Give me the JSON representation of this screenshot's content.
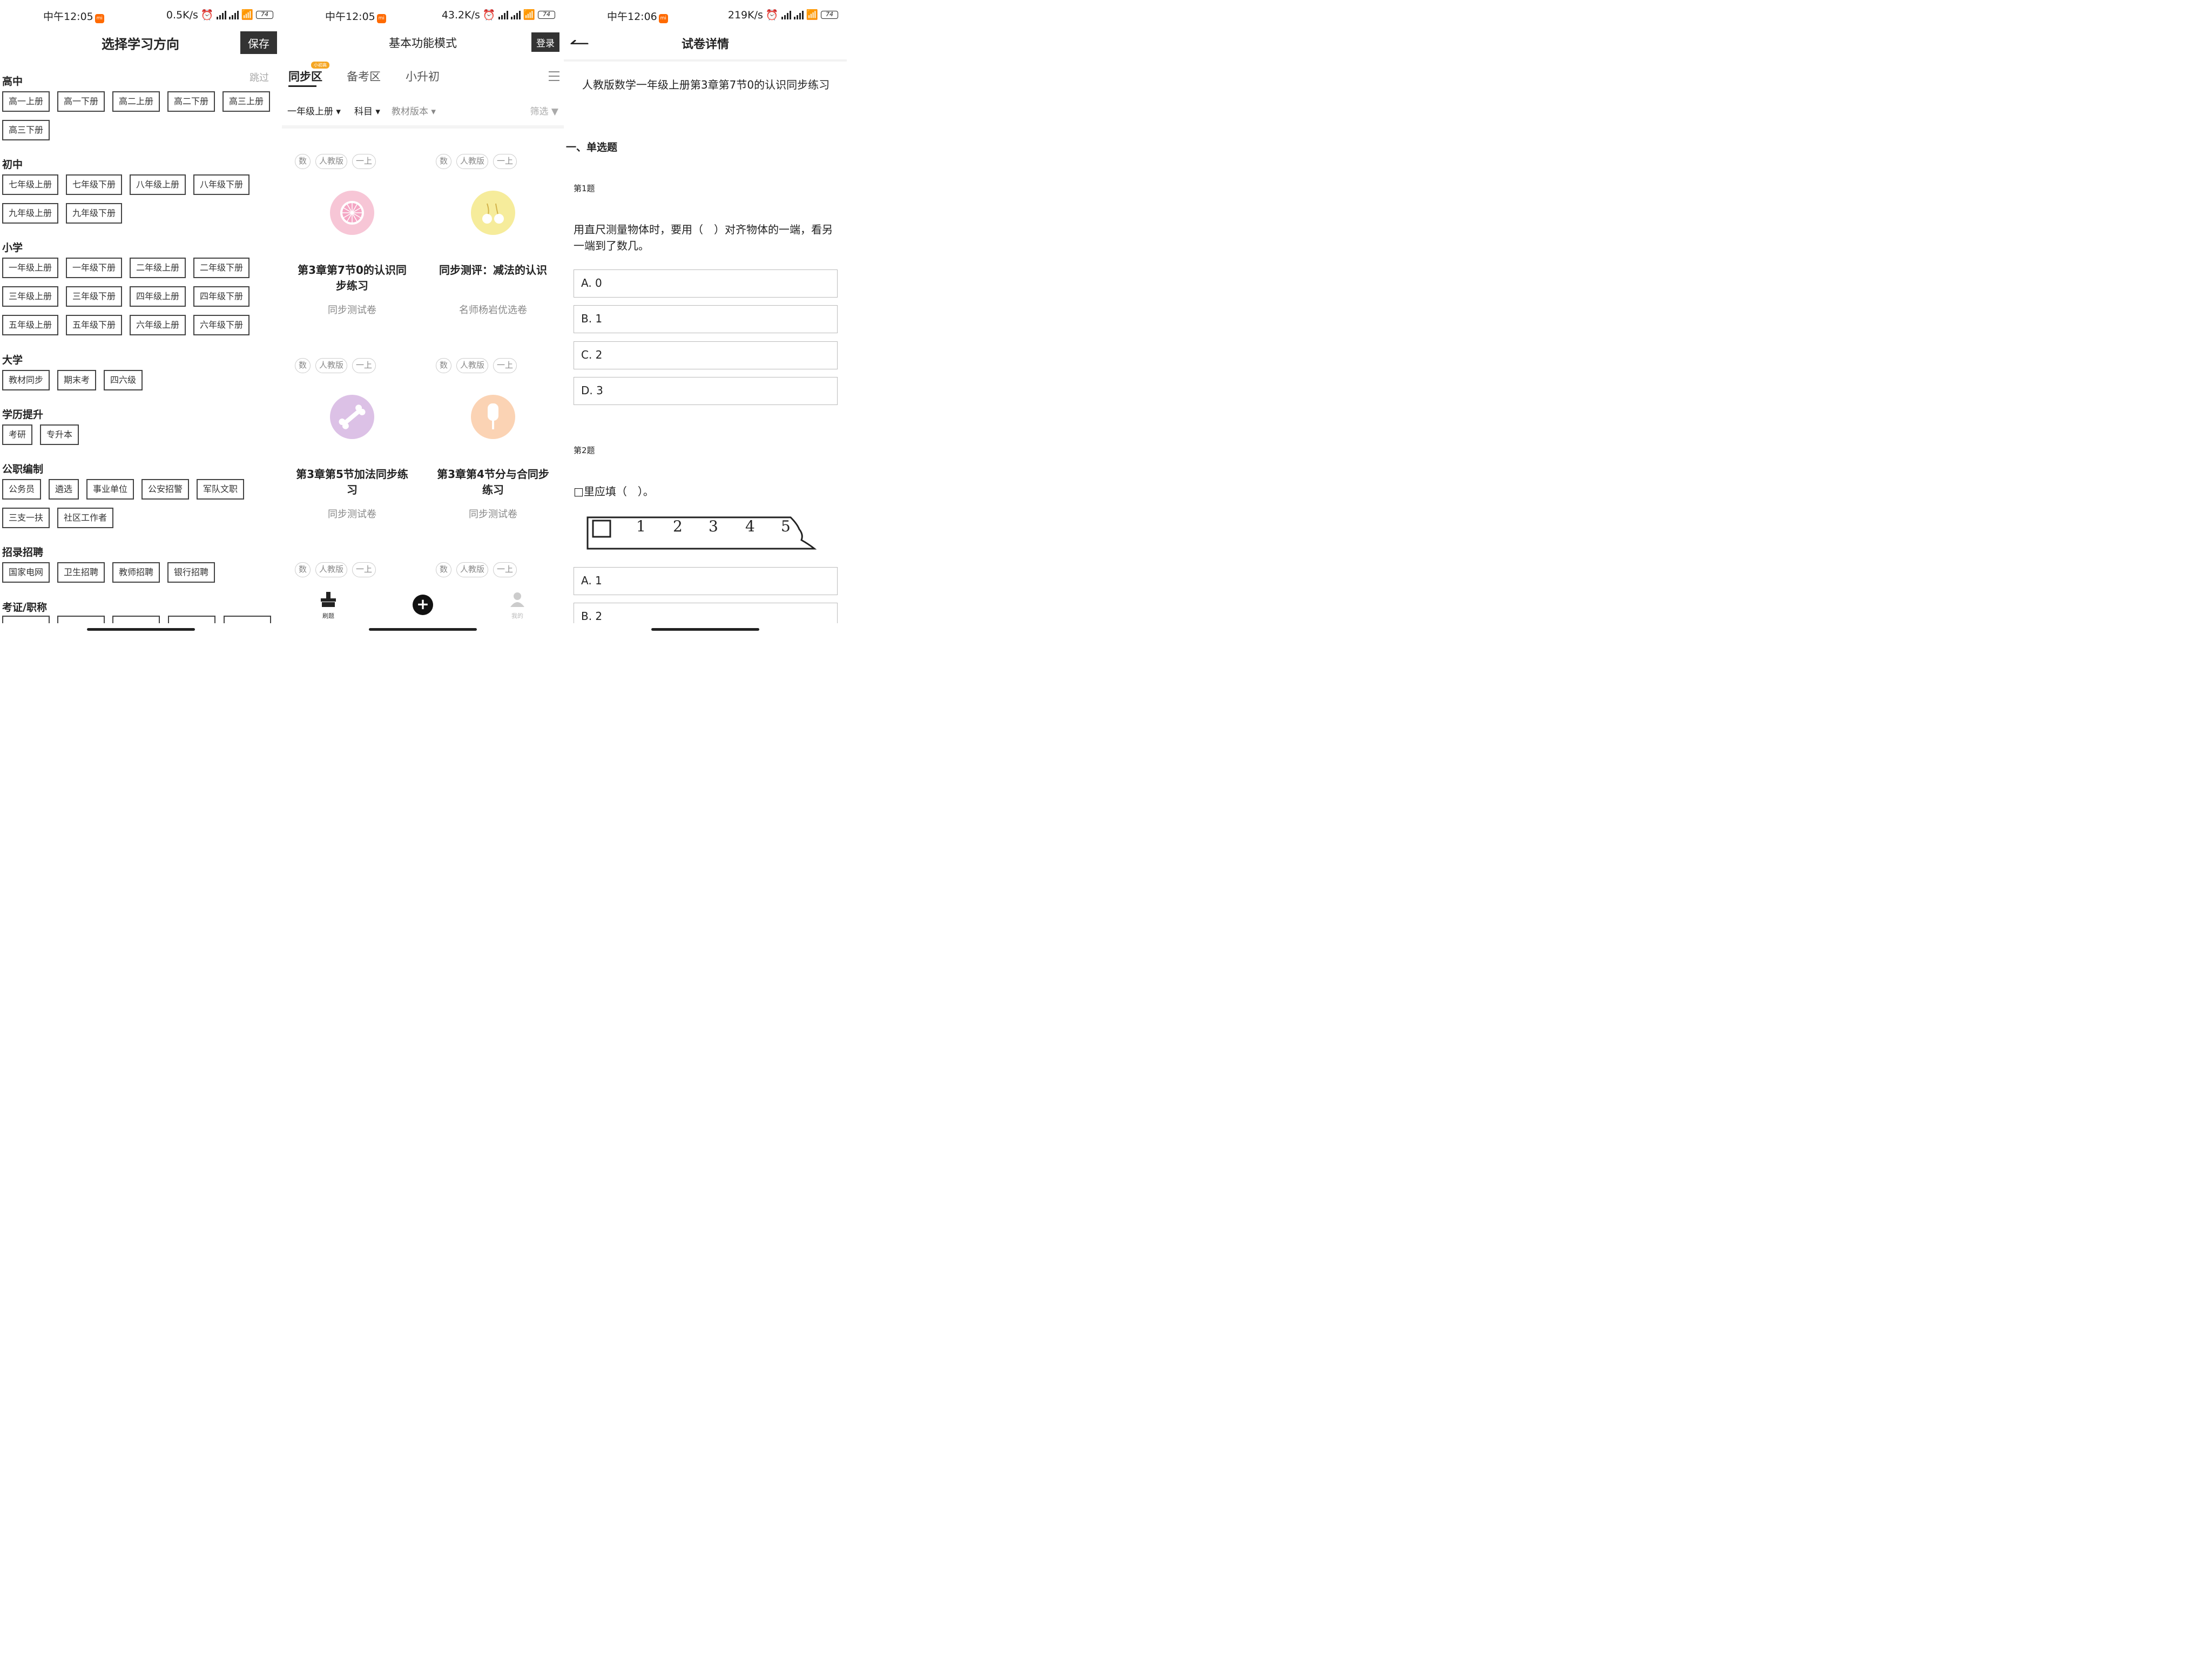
{
  "status_bars": [
    {
      "time": "中午12:05",
      "speed": "0.5K/s",
      "battery": "74"
    },
    {
      "time": "中午12:05",
      "speed": "43.2K/s",
      "battery": "74"
    },
    {
      "time": "中午12:06",
      "speed": "219K/s",
      "battery": "74"
    }
  ],
  "direction_screen": {
    "title": "选择学习方向",
    "save_label": "保存",
    "skip_label": "跳过",
    "sections": [
      {
        "title": "高中",
        "chips": [
          "高一上册",
          "高一下册",
          "高二上册",
          "高二下册",
          "高三上册",
          "高三下册"
        ]
      },
      {
        "title": "初中",
        "chips": [
          "七年级上册",
          "七年级下册",
          "八年级上册",
          "八年级下册",
          "九年级上册",
          "九年级下册"
        ]
      },
      {
        "title": "小学",
        "chips": [
          "一年级上册",
          "一年级下册",
          "二年级上册",
          "二年级下册",
          "三年级上册",
          "三年级下册",
          "四年级上册",
          "四年级下册",
          "五年级上册",
          "五年级下册",
          "六年级上册",
          "六年级下册"
        ]
      },
      {
        "title": "大学",
        "chips": [
          "教材同步",
          "期末考",
          "四六级"
        ]
      },
      {
        "title": "学历提升",
        "chips": [
          "考研",
          "专升本"
        ]
      },
      {
        "title": "公职编制",
        "chips": [
          "公务员",
          "遴选",
          "事业单位",
          "公安招警",
          "军队文职",
          "三支一扶",
          "社区工作者"
        ]
      },
      {
        "title": "招录招聘",
        "chips": [
          "国家电网",
          "卫生招聘",
          "教师招聘",
          "银行招聘"
        ]
      },
      {
        "title": "考证/职称",
        "chips": []
      }
    ]
  },
  "basic_screen": {
    "title": "基本功能模式",
    "login_label": "登录",
    "tabs": [
      "同步区",
      "备考区",
      "小升初"
    ],
    "badge": "小初高",
    "filters": [
      "一年级上册",
      "科目",
      "教材版本"
    ],
    "filter_right": "筛选",
    "tags": [
      "数",
      "人教版",
      "一上"
    ],
    "cards": [
      {
        "title": "第3章第7节0的认识同步练习",
        "sub": "同步测试卷",
        "color": "#f7c6d6",
        "icon": "citrus-slice-icon"
      },
      {
        "title": "同步测评：减法的认识",
        "sub": "名师杨岩优选卷",
        "color": "#f6ec9b",
        "icon": "cherries-icon"
      },
      {
        "title": "第3章第5节加法同步练习",
        "sub": "同步测试卷",
        "color": "#dcc1e6",
        "icon": "bone-icon"
      },
      {
        "title": "第3章第4节分与合同步练习",
        "sub": "同步测试卷",
        "color": "#fbd3b4",
        "icon": "popsicle-icon"
      }
    ],
    "nav": {
      "left": "刷题",
      "right": "我的"
    }
  },
  "paper_screen": {
    "title": "试卷详情",
    "paper_title": "人教版数学一年级上册第3章第7节0的认识同步练习",
    "section": "一、单选题",
    "q1": {
      "label": "第1题",
      "text": "用直尺测量物体时，要用（　）对齐物体的一端，看另一端到了数几。",
      "options": [
        "A. 0",
        "B. 1",
        "C. 2",
        "D. 3"
      ]
    },
    "q2": {
      "label": "第2题",
      "text": "□里应填（　）。",
      "ruler_marks": [
        "1",
        "2",
        "3",
        "4",
        "5"
      ],
      "options": [
        "A. 1",
        "B. 2"
      ]
    }
  }
}
